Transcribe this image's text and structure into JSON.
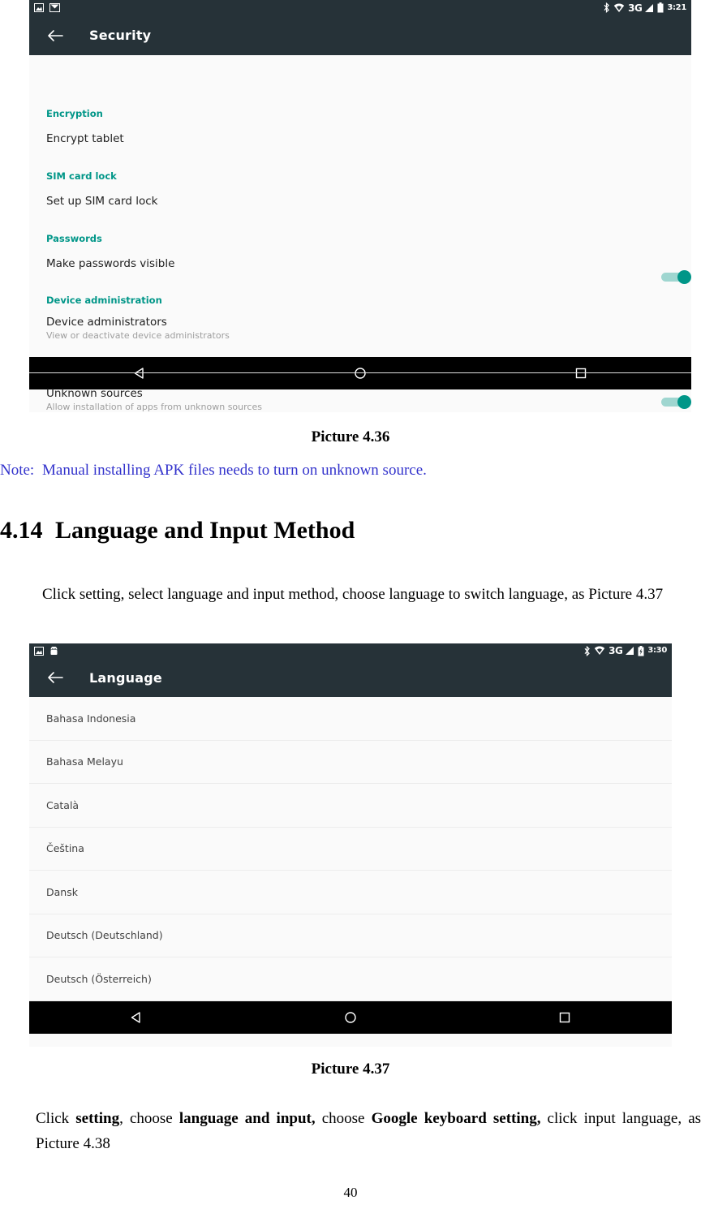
{
  "document": {
    "page_number": "40",
    "section": {
      "number": "4.14",
      "title": "Language and Input Method"
    },
    "figure_caption_1": "Picture 4.36",
    "figure_caption_2": "Picture 4.37",
    "note": {
      "label": "Note:",
      "text": "Manual installing APK files needs to turn on unknown source."
    },
    "paragraph_1": "Click setting, select language and input method, choose language to switch language, as Picture 4.37",
    "paragraph_2_parts": {
      "t1": "Click ",
      "b1": "setting",
      "t2": ", choose ",
      "b2": "language and input,",
      "t3": " choose ",
      "b3": "Google keyboard setting,",
      "t4": " click input language, as Picture 4.38"
    }
  },
  "colors": {
    "toolbar_bg": "#263238",
    "group_heading": "#009688",
    "toggle_on": "#009688",
    "toggle_track": "#9fd6d0",
    "note_text": "#3333cc",
    "navbar_bg": "#000000",
    "content_bg": "#fafafa"
  },
  "security_screen": {
    "statusbar": {
      "left_icons": [
        "screenshot-icon",
        "mail-icon"
      ],
      "right_icons": [
        "bluetooth-icon",
        "wifi-icon",
        "signal-icon",
        "battery-icon"
      ],
      "network": "3G",
      "time": "3:21"
    },
    "toolbar": {
      "back_label": "back-arrow",
      "title": "Security"
    },
    "groups": [
      {
        "heading": "Encryption",
        "rows": [
          {
            "title": "Encrypt tablet",
            "subtitle": "",
            "toggle": null
          }
        ]
      },
      {
        "heading": "SIM card lock",
        "rows": [
          {
            "title": "Set up SIM card lock",
            "subtitle": "",
            "toggle": null
          }
        ]
      },
      {
        "heading": "Passwords",
        "rows": [
          {
            "title": "Make passwords visible",
            "subtitle": "",
            "toggle": "on"
          }
        ]
      },
      {
        "heading": "Device administration",
        "rows": [
          {
            "title": "Device administrators",
            "subtitle": "View or deactivate device administrators",
            "toggle": null
          },
          {
            "title": "Unknown sources",
            "subtitle": "Allow installation of apps from unknown sources",
            "toggle": "on"
          }
        ]
      }
    ],
    "navbar": [
      "back-nav-icon",
      "home-nav-icon",
      "recents-nav-icon"
    ]
  },
  "language_screen": {
    "statusbar": {
      "left_icons": [
        "screenshot-icon",
        "android-icon"
      ],
      "right_icons": [
        "bluetooth-icon",
        "wifi-icon",
        "signal-icon",
        "battery-charging-icon"
      ],
      "network": "3G",
      "time": "3:30"
    },
    "toolbar": {
      "back_label": "back-arrow",
      "title": "Language"
    },
    "languages": [
      "Bahasa Indonesia",
      "Bahasa Melayu",
      "Català",
      "Čeština",
      "Dansk",
      "Deutsch (Deutschland)",
      "Deutsch (Österreich)"
    ],
    "navbar": [
      "back-nav-icon",
      "home-nav-icon",
      "recents-nav-icon"
    ]
  }
}
